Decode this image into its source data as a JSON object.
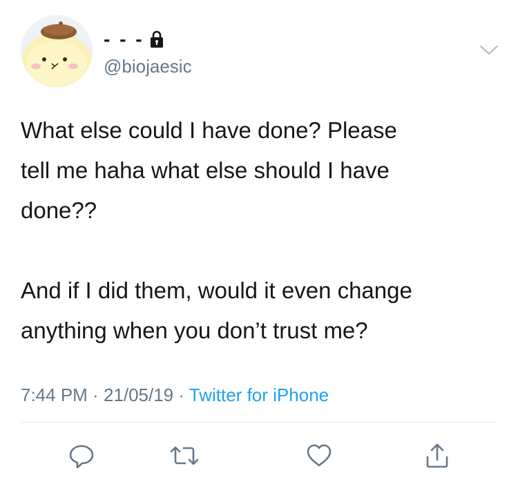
{
  "tweet": {
    "display_name": "- - -",
    "handle": "@biojaesic",
    "text": "What else could I have done? Please\ntell me haha what else should I have\ndone??\n\nAnd if I did them, would it even change\nanything when you don’t trust me?",
    "time": "7:44 PM",
    "separator": " · ",
    "date": "21/05/19",
    "source": "Twitter for iPhone"
  },
  "icons": {
    "lock": "lock-icon",
    "chevron": "chevron-down-icon",
    "reply": "reply-icon",
    "retweet": "retweet-icon",
    "like": "heart-icon",
    "share": "share-icon"
  },
  "colors": {
    "text": "#14171a",
    "secondary": "#657786",
    "link": "#1da1f2",
    "divider": "#e1e8ed"
  }
}
